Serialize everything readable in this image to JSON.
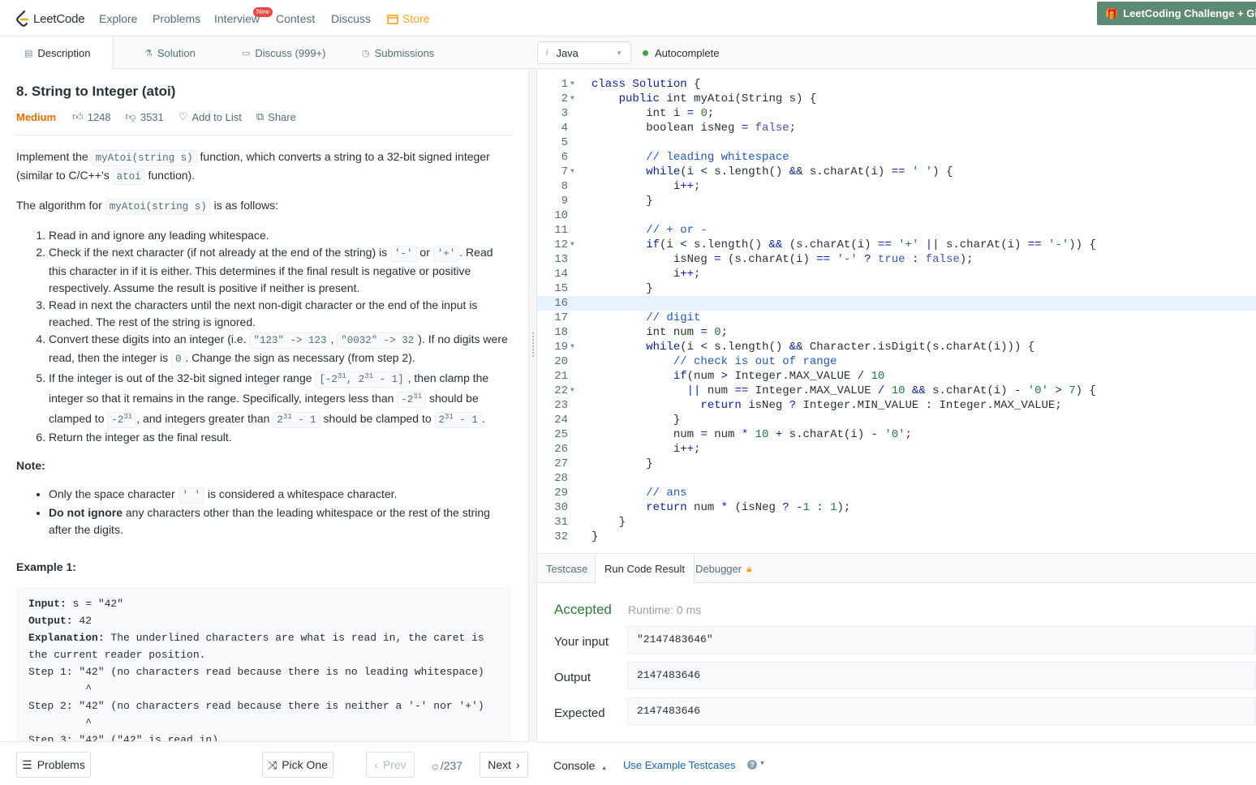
{
  "nav": {
    "logo": "LeetCode",
    "links": [
      "Explore",
      "Problems",
      "Interview",
      "Contest",
      "Discuss",
      "Store"
    ],
    "new_badge": "New",
    "challenge": "LeetCoding Challenge + Gi"
  },
  "tabs": [
    {
      "label": "Description",
      "icon": "document-icon"
    },
    {
      "label": "Solution",
      "icon": "flask-icon"
    },
    {
      "label": "Discuss (999+)",
      "icon": "chat-icon"
    },
    {
      "label": "Submissions",
      "icon": "clock-icon"
    }
  ],
  "problem": {
    "title": "8. String to Integer (atoi)",
    "difficulty": "Medium",
    "likes": "1248",
    "dislikes": "3531",
    "add_to_list": "Add to List",
    "share": "Share",
    "intro_1": "Implement the ",
    "intro_code1": "myAtoi(string s)",
    "intro_2": " function, which converts a string to a 32-bit signed integer (similar to C/C++'s ",
    "intro_code2": "atoi",
    "intro_3": " function).",
    "algo_1": "The algorithm for ",
    "algo_code": "myAtoi(string s)",
    "algo_2": " is as follows:",
    "steps": {
      "s1": "Read in and ignore any leading whitespace.",
      "s2a": "Check if the next character (if not already at the end of the string) is ",
      "s2c1": "'-'",
      "s2b": " or ",
      "s2c2": "'+'",
      "s2d": ". Read this character in if it is either. This determines if the final result is negative or positive respectively. Assume the result is positive if neither is present.",
      "s3": "Read in next the characters until the next non-digit character or the end of the input is reached. The rest of the string is ignored.",
      "s4a": "Convert these digits into an integer (i.e. ",
      "s4c1": "\"123\" -> 123",
      "s4b": ", ",
      "s4c2": "\"0032\" -> 32",
      "s4d": "). If no digits were read, then the integer is ",
      "s4c3": "0",
      "s4e": ". Change the sign as necessary (from step 2).",
      "s5a": "If the integer is out of the 32-bit signed integer range ",
      "s5b": ", then clamp the integer so that it remains in the range. Specifically, integers less than ",
      "s5c": " should be clamped to ",
      "s5d": ", and integers greater than ",
      "s5e": " should be clamped to ",
      "s6": "Return the integer as the final result."
    },
    "note_label": "Note:",
    "note1a": "Only the space character ",
    "note1c": "' '",
    "note1b": " is considered a whitespace character.",
    "note2b": "Do not ignore",
    "note2": " any characters other than the leading whitespace or the rest of the string after the digits.",
    "example_label": "Example 1:",
    "example_lines": [
      "Input: s = \"42\"",
      "Output: 42",
      "Explanation: The underlined characters are what is read in, the caret is",
      "the current reader position.",
      "Step 1: \"42\" (no characters read because there is no leading whitespace)",
      "         ^",
      "Step 2: \"42\" (no characters read because there is neither a '-' nor '+')",
      "         ^",
      "Step 3: \"42\" (\"42\" is read in)"
    ]
  },
  "bottom_left": {
    "problems": "Problems",
    "pick_one": "Pick One",
    "prev": "Prev",
    "pager": "/237",
    "next": "Next"
  },
  "editor": {
    "language": "Java",
    "autocomplete": "Autocomplete",
    "highlight_line": 16,
    "line_numbers": [
      "1",
      "2",
      "3",
      "4",
      "5",
      "6",
      "7",
      "8",
      "9",
      "10",
      "11",
      "12",
      "13",
      "14",
      "15",
      "16",
      "17",
      "18",
      "19",
      "20",
      "21",
      "22",
      "23",
      "24",
      "25",
      "26",
      "27",
      "28",
      "29",
      "30",
      "31",
      "32"
    ],
    "fold_lines": [
      1,
      2,
      7,
      12,
      19,
      22
    ]
  },
  "result": {
    "tabs": [
      "Testcase",
      "Run Code Result",
      "Debugger"
    ],
    "status": "Accepted",
    "runtime": "Runtime: 0 ms",
    "input_label": "Your input",
    "input_value": "\"2147483646\"",
    "output_label": "Output",
    "output_value": "2147483646",
    "expected_label": "Expected",
    "expected_value": "2147483646"
  },
  "bottom_right": {
    "console": "Console",
    "use_example": "Use Example Testcases"
  },
  "colors": {
    "medium": "#ef6c00",
    "accepted": "#2e7d32",
    "store": "#ffa116",
    "keyword": "#0b24a5",
    "comment": "#1e58c5",
    "highlight": "#e8f2ff"
  }
}
